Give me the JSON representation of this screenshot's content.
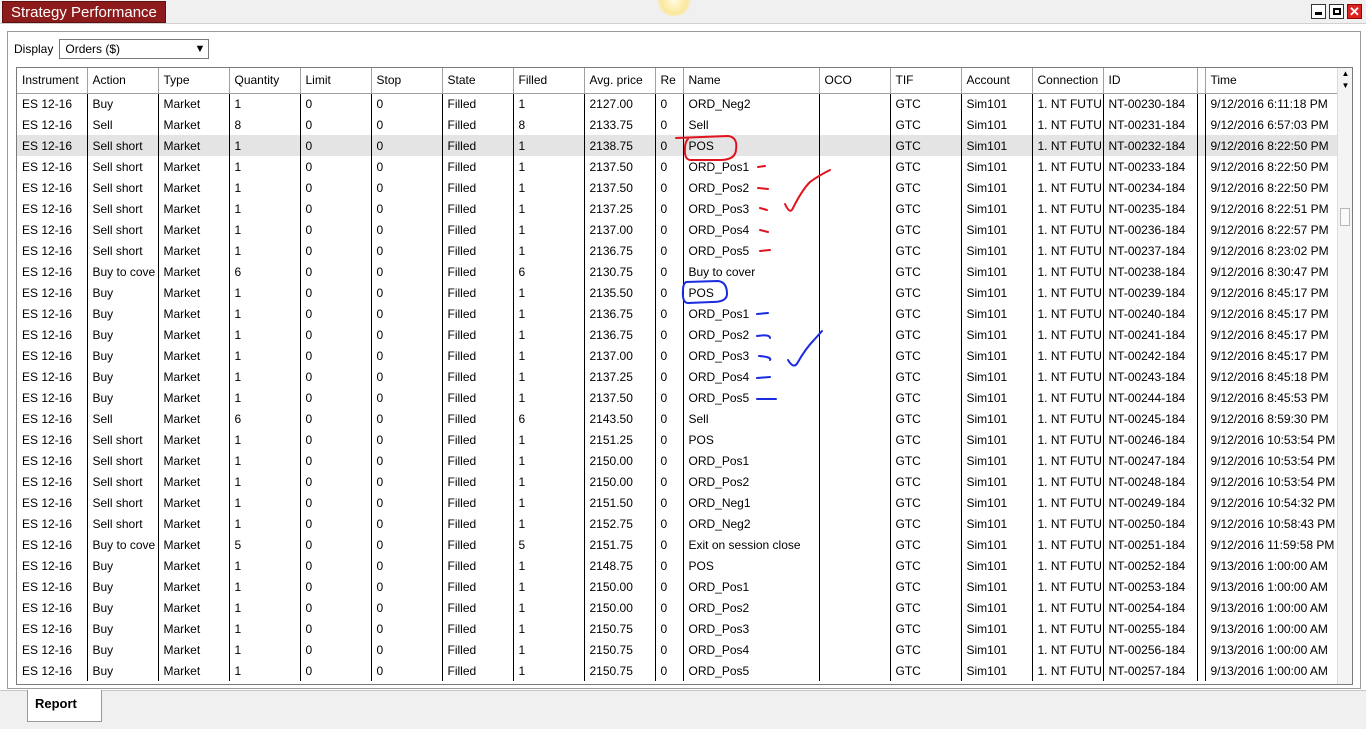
{
  "window": {
    "title": "Strategy Performance",
    "controls": {
      "minimize": "minimize-icon",
      "restore": "restore-icon",
      "close": "close-icon",
      "close_glyph": "✕"
    }
  },
  "display": {
    "label": "Display",
    "selected": "Orders ($)",
    "arrow": "▼"
  },
  "table": {
    "columns": [
      "Instrument",
      "Action",
      "Type",
      "Quantity",
      "Limit",
      "Stop",
      "State",
      "Filled",
      "Avg. price",
      "Re",
      "Name",
      "OCO",
      "TIF",
      "Account",
      "Connection",
      "ID",
      "",
      "Time"
    ],
    "rows": [
      [
        "ES 12-16",
        "Buy",
        "Market",
        "1",
        "0",
        "0",
        "Filled",
        "1",
        "2127.00",
        "0",
        "ORD_Neg2",
        "",
        "GTC",
        "Sim101",
        "1. NT FUTU",
        "NT-00230-184",
        "",
        "9/12/2016 6:11:18 PM"
      ],
      [
        "ES 12-16",
        "Sell",
        "Market",
        "8",
        "0",
        "0",
        "Filled",
        "8",
        "2133.75",
        "0",
        "Sell",
        "",
        "GTC",
        "Sim101",
        "1. NT FUTU",
        "NT-00231-184",
        "",
        "9/12/2016 6:57:03 PM"
      ],
      [
        "ES 12-16",
        "Sell short",
        "Market",
        "1",
        "0",
        "0",
        "Filled",
        "1",
        "2138.75",
        "0",
        "POS",
        "",
        "GTC",
        "Sim101",
        "1. NT FUTU",
        "NT-00232-184",
        "",
        "9/12/2016 8:22:50 PM"
      ],
      [
        "ES 12-16",
        "Sell short",
        "Market",
        "1",
        "0",
        "0",
        "Filled",
        "1",
        "2137.50",
        "0",
        "ORD_Pos1",
        "",
        "GTC",
        "Sim101",
        "1. NT FUTU",
        "NT-00233-184",
        "",
        "9/12/2016 8:22:50 PM"
      ],
      [
        "ES 12-16",
        "Sell short",
        "Market",
        "1",
        "0",
        "0",
        "Filled",
        "1",
        "2137.50",
        "0",
        "ORD_Pos2",
        "",
        "GTC",
        "Sim101",
        "1. NT FUTU",
        "NT-00234-184",
        "",
        "9/12/2016 8:22:50 PM"
      ],
      [
        "ES 12-16",
        "Sell short",
        "Market",
        "1",
        "0",
        "0",
        "Filled",
        "1",
        "2137.25",
        "0",
        "ORD_Pos3",
        "",
        "GTC",
        "Sim101",
        "1. NT FUTU",
        "NT-00235-184",
        "",
        "9/12/2016 8:22:51 PM"
      ],
      [
        "ES 12-16",
        "Sell short",
        "Market",
        "1",
        "0",
        "0",
        "Filled",
        "1",
        "2137.00",
        "0",
        "ORD_Pos4",
        "",
        "GTC",
        "Sim101",
        "1. NT FUTU",
        "NT-00236-184",
        "",
        "9/12/2016 8:22:57 PM"
      ],
      [
        "ES 12-16",
        "Sell short",
        "Market",
        "1",
        "0",
        "0",
        "Filled",
        "1",
        "2136.75",
        "0",
        "ORD_Pos5",
        "",
        "GTC",
        "Sim101",
        "1. NT FUTU",
        "NT-00237-184",
        "",
        "9/12/2016 8:23:02 PM"
      ],
      [
        "ES 12-16",
        "Buy to cove",
        "Market",
        "6",
        "0",
        "0",
        "Filled",
        "6",
        "2130.75",
        "0",
        "Buy to cover",
        "",
        "GTC",
        "Sim101",
        "1. NT FUTU",
        "NT-00238-184",
        "",
        "9/12/2016 8:30:47 PM"
      ],
      [
        "ES 12-16",
        "Buy",
        "Market",
        "1",
        "0",
        "0",
        "Filled",
        "1",
        "2135.50",
        "0",
        "POS",
        "",
        "GTC",
        "Sim101",
        "1. NT FUTU",
        "NT-00239-184",
        "",
        "9/12/2016 8:45:17 PM"
      ],
      [
        "ES 12-16",
        "Buy",
        "Market",
        "1",
        "0",
        "0",
        "Filled",
        "1",
        "2136.75",
        "0",
        "ORD_Pos1",
        "",
        "GTC",
        "Sim101",
        "1. NT FUTU",
        "NT-00240-184",
        "",
        "9/12/2016 8:45:17 PM"
      ],
      [
        "ES 12-16",
        "Buy",
        "Market",
        "1",
        "0",
        "0",
        "Filled",
        "1",
        "2136.75",
        "0",
        "ORD_Pos2",
        "",
        "GTC",
        "Sim101",
        "1. NT FUTU",
        "NT-00241-184",
        "",
        "9/12/2016 8:45:17 PM"
      ],
      [
        "ES 12-16",
        "Buy",
        "Market",
        "1",
        "0",
        "0",
        "Filled",
        "1",
        "2137.00",
        "0",
        "ORD_Pos3",
        "",
        "GTC",
        "Sim101",
        "1. NT FUTU",
        "NT-00242-184",
        "",
        "9/12/2016 8:45:17 PM"
      ],
      [
        "ES 12-16",
        "Buy",
        "Market",
        "1",
        "0",
        "0",
        "Filled",
        "1",
        "2137.25",
        "0",
        "ORD_Pos4",
        "",
        "GTC",
        "Sim101",
        "1. NT FUTU",
        "NT-00243-184",
        "",
        "9/12/2016 8:45:18 PM"
      ],
      [
        "ES 12-16",
        "Buy",
        "Market",
        "1",
        "0",
        "0",
        "Filled",
        "1",
        "2137.50",
        "0",
        "ORD_Pos5",
        "",
        "GTC",
        "Sim101",
        "1. NT FUTU",
        "NT-00244-184",
        "",
        "9/12/2016 8:45:53 PM"
      ],
      [
        "ES 12-16",
        "Sell",
        "Market",
        "6",
        "0",
        "0",
        "Filled",
        "6",
        "2143.50",
        "0",
        "Sell",
        "",
        "GTC",
        "Sim101",
        "1. NT FUTU",
        "NT-00245-184",
        "",
        "9/12/2016 8:59:30 PM"
      ],
      [
        "ES 12-16",
        "Sell short",
        "Market",
        "1",
        "0",
        "0",
        "Filled",
        "1",
        "2151.25",
        "0",
        "POS",
        "",
        "GTC",
        "Sim101",
        "1. NT FUTU",
        "NT-00246-184",
        "",
        "9/12/2016 10:53:54 PM"
      ],
      [
        "ES 12-16",
        "Sell short",
        "Market",
        "1",
        "0",
        "0",
        "Filled",
        "1",
        "2150.00",
        "0",
        "ORD_Pos1",
        "",
        "GTC",
        "Sim101",
        "1. NT FUTU",
        "NT-00247-184",
        "",
        "9/12/2016 10:53:54 PM"
      ],
      [
        "ES 12-16",
        "Sell short",
        "Market",
        "1",
        "0",
        "0",
        "Filled",
        "1",
        "2150.00",
        "0",
        "ORD_Pos2",
        "",
        "GTC",
        "Sim101",
        "1. NT FUTU",
        "NT-00248-184",
        "",
        "9/12/2016 10:53:54 PM"
      ],
      [
        "ES 12-16",
        "Sell short",
        "Market",
        "1",
        "0",
        "0",
        "Filled",
        "1",
        "2151.50",
        "0",
        "ORD_Neg1",
        "",
        "GTC",
        "Sim101",
        "1. NT FUTU",
        "NT-00249-184",
        "",
        "9/12/2016 10:54:32 PM"
      ],
      [
        "ES 12-16",
        "Sell short",
        "Market",
        "1",
        "0",
        "0",
        "Filled",
        "1",
        "2152.75",
        "0",
        "ORD_Neg2",
        "",
        "GTC",
        "Sim101",
        "1. NT FUTU",
        "NT-00250-184",
        "",
        "9/12/2016 10:58:43 PM"
      ],
      [
        "ES 12-16",
        "Buy to cove",
        "Market",
        "5",
        "0",
        "0",
        "Filled",
        "5",
        "2151.75",
        "0",
        "Exit on session close",
        "",
        "GTC",
        "Sim101",
        "1. NT FUTU",
        "NT-00251-184",
        "",
        "9/12/2016 11:59:58 PM"
      ],
      [
        "ES 12-16",
        "Buy",
        "Market",
        "1",
        "0",
        "0",
        "Filled",
        "1",
        "2148.75",
        "0",
        "POS",
        "",
        "GTC",
        "Sim101",
        "1. NT FUTU",
        "NT-00252-184",
        "",
        "9/13/2016 1:00:00 AM"
      ],
      [
        "ES 12-16",
        "Buy",
        "Market",
        "1",
        "0",
        "0",
        "Filled",
        "1",
        "2150.00",
        "0",
        "ORD_Pos1",
        "",
        "GTC",
        "Sim101",
        "1. NT FUTU",
        "NT-00253-184",
        "",
        "9/13/2016 1:00:00 AM"
      ],
      [
        "ES 12-16",
        "Buy",
        "Market",
        "1",
        "0",
        "0",
        "Filled",
        "1",
        "2150.00",
        "0",
        "ORD_Pos2",
        "",
        "GTC",
        "Sim101",
        "1. NT FUTU",
        "NT-00254-184",
        "",
        "9/13/2016 1:00:00 AM"
      ],
      [
        "ES 12-16",
        "Buy",
        "Market",
        "1",
        "0",
        "0",
        "Filled",
        "1",
        "2150.75",
        "0",
        "ORD_Pos3",
        "",
        "GTC",
        "Sim101",
        "1. NT FUTU",
        "NT-00255-184",
        "",
        "9/13/2016 1:00:00 AM"
      ],
      [
        "ES 12-16",
        "Buy",
        "Market",
        "1",
        "0",
        "0",
        "Filled",
        "1",
        "2150.75",
        "0",
        "ORD_Pos4",
        "",
        "GTC",
        "Sim101",
        "1. NT FUTU",
        "NT-00256-184",
        "",
        "9/13/2016 1:00:00 AM"
      ],
      [
        "ES 12-16",
        "Buy",
        "Market",
        "1",
        "0",
        "0",
        "Filled",
        "1",
        "2150.75",
        "0",
        "ORD_Pos5",
        "",
        "GTC",
        "Sim101",
        "1. NT FUTU",
        "NT-00257-184",
        "",
        "9/13/2016 1:00:00 AM"
      ]
    ],
    "selected_row": 2,
    "scroll": {
      "up": "▲",
      "down": "▼"
    }
  },
  "tabs": {
    "report": "Report"
  },
  "annotations": {
    "red": "#e0141e",
    "blue": "#1a2be0"
  },
  "colors": {
    "title_tab": "#8e1b1b",
    "selected_row": "#e4e4e4"
  }
}
